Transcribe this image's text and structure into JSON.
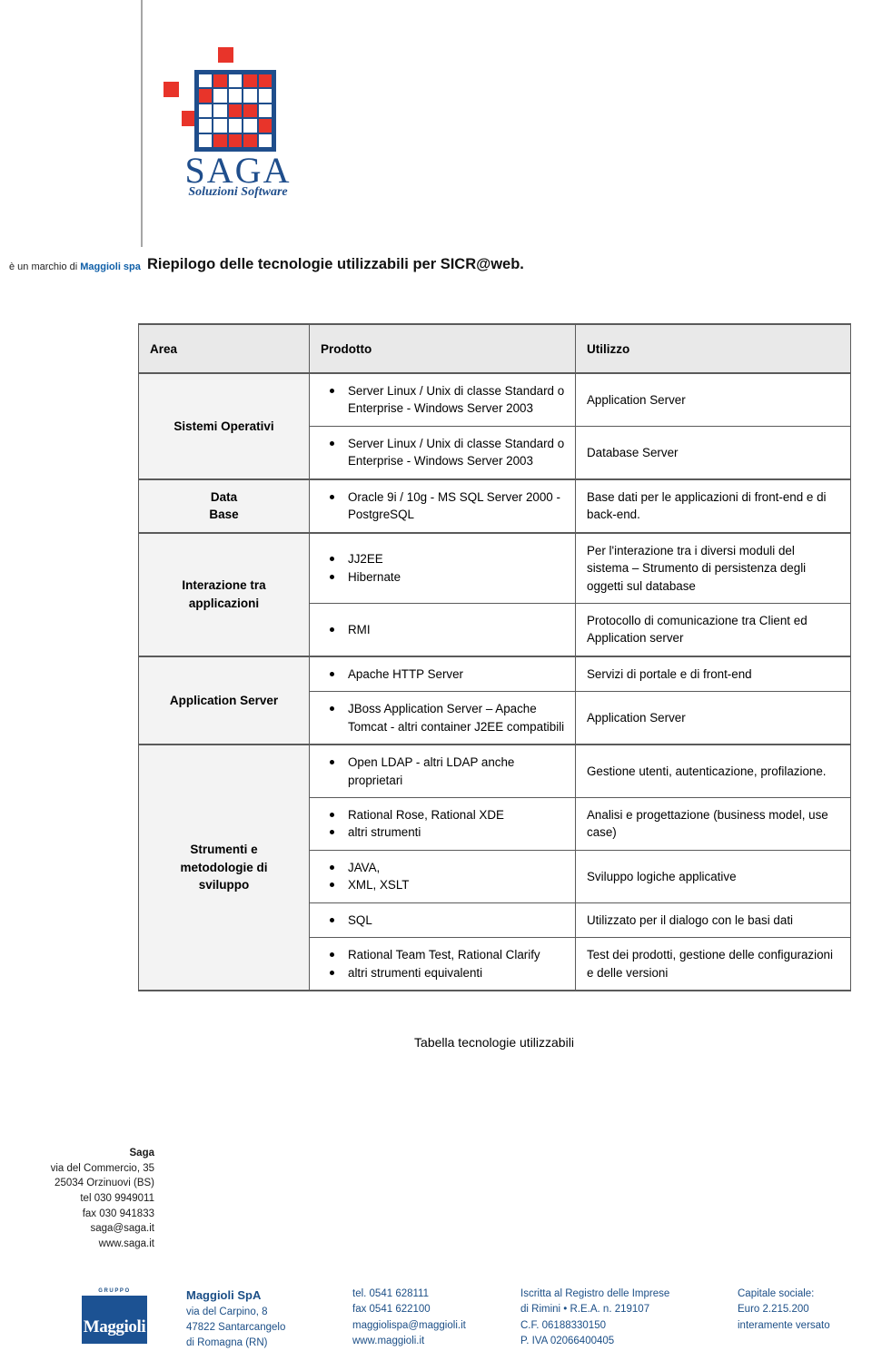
{
  "header": {
    "brand_prefix": "è un marchio di ",
    "brand_name": "Maggioli spa",
    "title": "Riepilogo delle tecnologie utilizzabili per SICR@web."
  },
  "logo": {
    "wordmark": "SAGA",
    "tagline": "Soluzioni Software",
    "blue": "#1f4e8c",
    "red": "#e8342a"
  },
  "table": {
    "columns": [
      "Area",
      "Prodotto",
      "Utilizzo"
    ],
    "rows": [
      {
        "area": "Sistemi Operativi",
        "entries": [
          {
            "products": [
              "Server Linux / Unix di classe Standard o Enterprise - Windows Server 2003"
            ],
            "usage": "Application Server"
          },
          {
            "products": [
              "Server Linux / Unix di classe Standard o Enterprise - Windows Server 2003"
            ],
            "usage": "Database Server"
          }
        ]
      },
      {
        "area": "Data\nBase",
        "entries": [
          {
            "products": [
              "Oracle 9i / 10g - MS SQL Server 2000 - PostgreSQL"
            ],
            "usage": "Base dati per le applicazioni di front-end e di back-end."
          }
        ]
      },
      {
        "area": "Interazione tra\napplicazioni",
        "entries": [
          {
            "products": [
              "JJ2EE",
              "Hibernate"
            ],
            "usage": "Per l'interazione tra i diversi moduli del sistema – Strumento di persistenza degli oggetti sul database"
          },
          {
            "products": [
              "RMI"
            ],
            "usage": "Protocollo di comunicazione tra Client ed Application server"
          }
        ]
      },
      {
        "area": "Application Server",
        "entries": [
          {
            "products": [
              "Apache HTTP Server"
            ],
            "usage": "Servizi di portale e di front-end"
          },
          {
            "products": [
              "JBoss Application Server – Apache Tomcat - altri container J2EE compatibili"
            ],
            "usage": "Application Server"
          }
        ]
      },
      {
        "area": "Strumenti e\nmetodologie di\nsviluppo",
        "entries": [
          {
            "products": [
              "Open LDAP - altri LDAP anche proprietari"
            ],
            "usage": "Gestione utenti, autenticazione, profilazione."
          },
          {
            "products": [
              "Rational Rose, Rational XDE",
              "altri strumenti"
            ],
            "usage": "Analisi e progettazione (business model, use case)"
          },
          {
            "products": [
              "JAVA,",
              "XML, XSLT"
            ],
            "usage": "Sviluppo logiche applicative"
          },
          {
            "products": [
              "SQL"
            ],
            "usage": "Utilizzato per il dialogo con le basi dati"
          },
          {
            "products": [
              "Rational Team Test, Rational Clarify",
              "altri strumenti equivalenti"
            ],
            "usage": "Test dei prodotti, gestione delle configurazioni e delle versioni"
          }
        ]
      }
    ],
    "caption": "Tabella tecnologie utilizzabili"
  },
  "saga_address": {
    "name": "Saga",
    "lines": [
      "via del Commercio, 35",
      "25034 Orzinuovi (BS)",
      "tel  030 9949011",
      "fax 030 941833",
      "saga@saga.it",
      "www.saga.it"
    ]
  },
  "footer": {
    "logo_top_text": "GRUPPO",
    "logo_text": "Maggioli",
    "company": {
      "name": "Maggioli SpA",
      "lines": [
        "via del Carpino, 8",
        "47822 Santarcangelo",
        "di Romagna (RN)"
      ]
    },
    "contact": {
      "lines": [
        "tel. 0541 628111",
        "fax 0541 622100",
        "maggiolispa@maggioli.it",
        "www.maggioli.it"
      ]
    },
    "registry": {
      "lines": [
        "Iscritta al Registro delle Imprese",
        "di Rimini • R.E.A. n. 219107",
        "C.F. 06188330150",
        "P. IVA 02066400405"
      ]
    },
    "capital": {
      "lines": [
        "Capitale sociale:",
        "Euro 2.215.200",
        "interamente versato"
      ]
    }
  }
}
